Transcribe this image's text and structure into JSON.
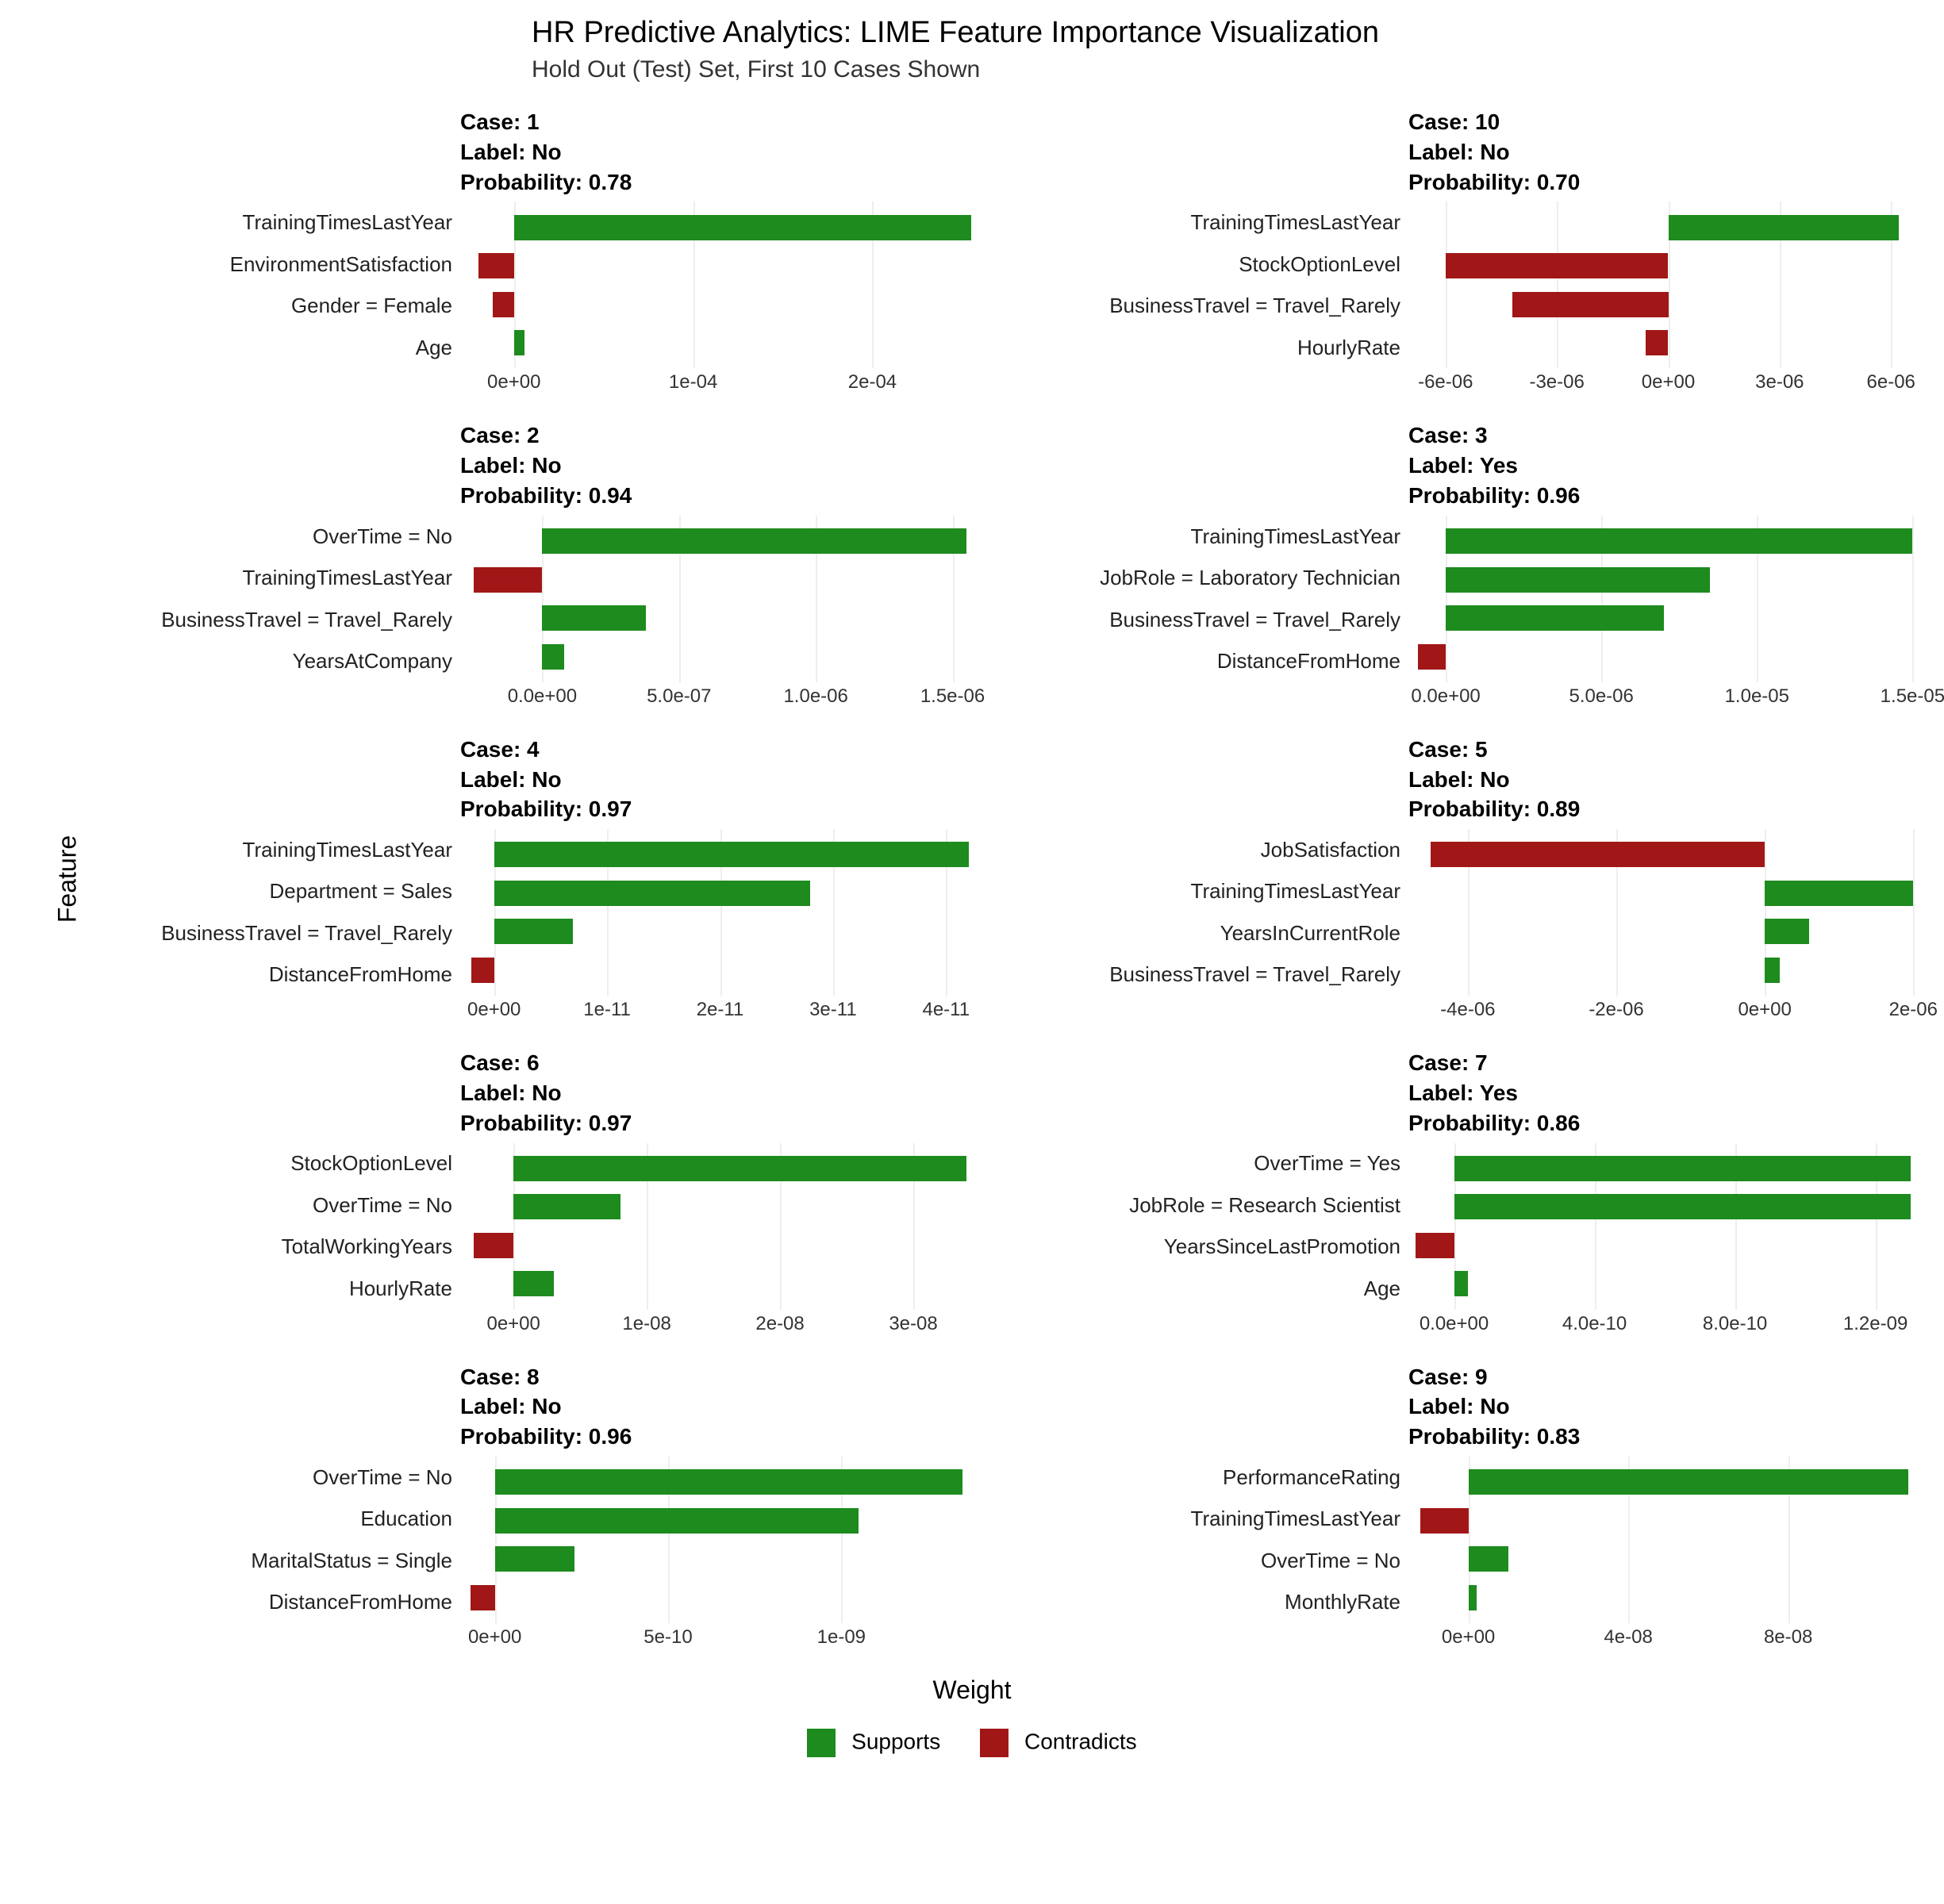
{
  "title": "HR Predictive Analytics: LIME Feature Importance Visualization",
  "subtitle": "Hold Out (Test) Set, First 10 Cases Shown",
  "xlabel": "Weight",
  "ylabel": "Feature",
  "legend": {
    "supports": "Supports",
    "contradicts": "Contradicts"
  },
  "colors": {
    "supports": "#1d8b1d",
    "contradicts": "#a11717"
  },
  "chart_data": [
    {
      "case": 1,
      "label": "No",
      "probability": 0.78,
      "features": [
        "TrainingTimesLastYear",
        "EnvironmentSatisfaction",
        "Gender = Female",
        "Age"
      ],
      "values": [
        0.000255,
        -2e-05,
        -1.2e-05,
        6e-06
      ],
      "xmin": -3e-05,
      "xmax": 0.00026,
      "ticks": [
        0,
        0.0001,
        0.0002
      ],
      "tick_labels": [
        "0e+00",
        "1e-04",
        "2e-04"
      ]
    },
    {
      "case": 10,
      "label": "No",
      "probability": 0.7,
      "features": [
        "TrainingTimesLastYear",
        "StockOptionLevel",
        "BusinessTravel = Travel_Rarely",
        "HourlyRate"
      ],
      "values": [
        6.2e-06,
        -6e-06,
        -4.2e-06,
        -6e-07
      ],
      "xmin": -7e-06,
      "xmax": 7e-06,
      "ticks": [
        -6e-06,
        -3e-06,
        0,
        3e-06,
        6e-06
      ],
      "tick_labels": [
        "-6e-06",
        "-3e-06",
        "0e+00",
        "3e-06",
        "6e-06"
      ]
    },
    {
      "case": 2,
      "label": "No",
      "probability": 0.94,
      "features": [
        "OverTime = No",
        "TrainingTimesLastYear",
        "BusinessTravel = Travel_Rarely",
        "YearsAtCompany"
      ],
      "values": [
        1.55e-06,
        -2.5e-07,
        3.8e-07,
        8e-08
      ],
      "xmin": -3e-07,
      "xmax": 1.6e-06,
      "ticks": [
        0,
        5e-07,
        1e-06,
        1.5e-06
      ],
      "tick_labels": [
        "0.0e+00",
        "5.0e-07",
        "1.0e-06",
        "1.5e-06"
      ]
    },
    {
      "case": 3,
      "label": "Yes",
      "probability": 0.96,
      "features": [
        "TrainingTimesLastYear",
        "JobRole = Laboratory Technician",
        "BusinessTravel = Travel_Rarely",
        "DistanceFromHome"
      ],
      "values": [
        1.5e-05,
        8.5e-06,
        7e-06,
        -9e-07
      ],
      "xmin": -1.2e-06,
      "xmax": 1.55e-05,
      "ticks": [
        0,
        5e-06,
        1e-05,
        1.5e-05
      ],
      "tick_labels": [
        "0.0e+00",
        "5.0e-06",
        "1.0e-05",
        "1.5e-05"
      ]
    },
    {
      "case": 4,
      "label": "No",
      "probability": 0.97,
      "features": [
        "TrainingTimesLastYear",
        "Department = Sales",
        "BusinessTravel = Travel_Rarely",
        "DistanceFromHome"
      ],
      "values": [
        4.2e-11,
        2.8e-11,
        7e-12,
        -2e-12
      ],
      "xmin": -3e-12,
      "xmax": 4.3e-11,
      "ticks": [
        0,
        1e-11,
        2e-11,
        3e-11,
        4e-11
      ],
      "tick_labels": [
        "0e+00",
        "1e-11",
        "2e-11",
        "3e-11",
        "4e-11"
      ]
    },
    {
      "case": 5,
      "label": "No",
      "probability": 0.89,
      "features": [
        "JobSatisfaction",
        "TrainingTimesLastYear",
        "YearsInCurrentRole",
        "BusinessTravel = Travel_Rarely"
      ],
      "values": [
        -4.5e-06,
        2e-06,
        6e-07,
        2e-07
      ],
      "xmin": -4.8e-06,
      "xmax": 2.2e-06,
      "ticks": [
        -4e-06,
        -2e-06,
        0,
        2e-06
      ],
      "tick_labels": [
        "-4e-06",
        "-2e-06",
        "0e+00",
        "2e-06"
      ]
    },
    {
      "case": 6,
      "label": "No",
      "probability": 0.97,
      "features": [
        "StockOptionLevel",
        "OverTime = No",
        "TotalWorkingYears",
        "HourlyRate"
      ],
      "values": [
        3.4e-08,
        8e-09,
        -3e-09,
        3e-09
      ],
      "xmin": -4e-09,
      "xmax": 3.5e-08,
      "ticks": [
        0,
        1e-08,
        2e-08,
        3e-08
      ],
      "tick_labels": [
        "0e+00",
        "1e-08",
        "2e-08",
        "3e-08"
      ]
    },
    {
      "case": 7,
      "label": "Yes",
      "probability": 0.86,
      "features": [
        "OverTime = Yes",
        "JobRole = Research Scientist",
        "YearsSinceLastPromotion",
        "Age"
      ],
      "values": [
        1.3e-09,
        1.3e-09,
        -1.1e-10,
        4e-11
      ],
      "xmin": -1.3e-10,
      "xmax": 1.35e-09,
      "ticks": [
        0,
        4e-10,
        8e-10,
        1.2e-09
      ],
      "tick_labels": [
        "0.0e+00",
        "4.0e-10",
        "8.0e-10",
        "1.2e-09"
      ]
    },
    {
      "case": 8,
      "label": "No",
      "probability": 0.96,
      "features": [
        "OverTime = No",
        "Education",
        "MaritalStatus = Single",
        "DistanceFromHome"
      ],
      "values": [
        1.35e-09,
        1.05e-09,
        2.3e-10,
        -7e-11
      ],
      "xmin": -1e-10,
      "xmax": 1.4e-09,
      "ticks": [
        0,
        5e-10,
        1e-09
      ],
      "tick_labels": [
        "0e+00",
        "5e-10",
        "1e-09"
      ]
    },
    {
      "case": 9,
      "label": "No",
      "probability": 0.83,
      "features": [
        "PerformanceRating",
        "TrainingTimesLastYear",
        "OverTime = No",
        "MonthlyRate"
      ],
      "values": [
        1.1e-07,
        -1.2e-08,
        1e-08,
        2e-09
      ],
      "xmin": -1.5e-08,
      "xmax": 1.15e-07,
      "ticks": [
        0,
        4e-08,
        8e-08
      ],
      "tick_labels": [
        "0e+00",
        "4e-08",
        "8e-08"
      ]
    }
  ]
}
